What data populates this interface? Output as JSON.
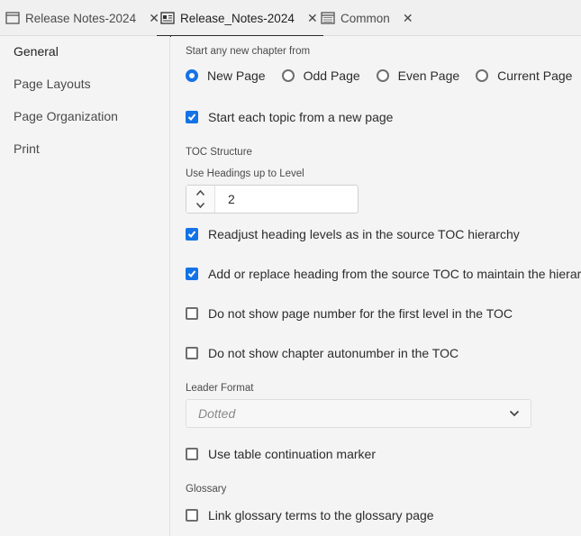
{
  "tabs": [
    {
      "label": "Release Notes-2024",
      "icon": "window-icon",
      "active": false
    },
    {
      "label": "Release_Notes-2024",
      "icon": "document-icon",
      "active": true
    },
    {
      "label": "Common",
      "icon": "window-grid-icon",
      "active": false
    }
  ],
  "sidebar": {
    "items": [
      {
        "label": "General",
        "active": true
      },
      {
        "label": "Page Layouts"
      },
      {
        "label": "Page Organization"
      },
      {
        "label": "Print"
      }
    ]
  },
  "chapter": {
    "label": "Start any new chapter from",
    "options": [
      "New Page",
      "Odd Page",
      "Even Page",
      "Current Page"
    ],
    "selected": "New Page"
  },
  "topic_new_page": {
    "label": "Start each topic from a new page",
    "checked": true
  },
  "toc": {
    "section_label": "TOC Structure",
    "headings_label": "Use Headings up to Level",
    "headings_value": "2",
    "options": [
      {
        "label": "Readjust heading levels as in the source TOC hierarchy",
        "checked": true
      },
      {
        "label": "Add or replace heading from the source TOC to maintain the hierarchy",
        "checked": true
      },
      {
        "label": "Do not show page number for the first level in the TOC",
        "checked": false
      },
      {
        "label": "Do not show chapter autonumber in the TOC",
        "checked": false
      }
    ]
  },
  "leader": {
    "label": "Leader Format",
    "value": "Dotted"
  },
  "table_marker": {
    "label": "Use table continuation marker",
    "checked": false
  },
  "glossary": {
    "section_label": "Glossary",
    "link_label": "Link glossary terms to the glossary page",
    "checked": false
  },
  "colors": {
    "accent": "#1473e6"
  }
}
